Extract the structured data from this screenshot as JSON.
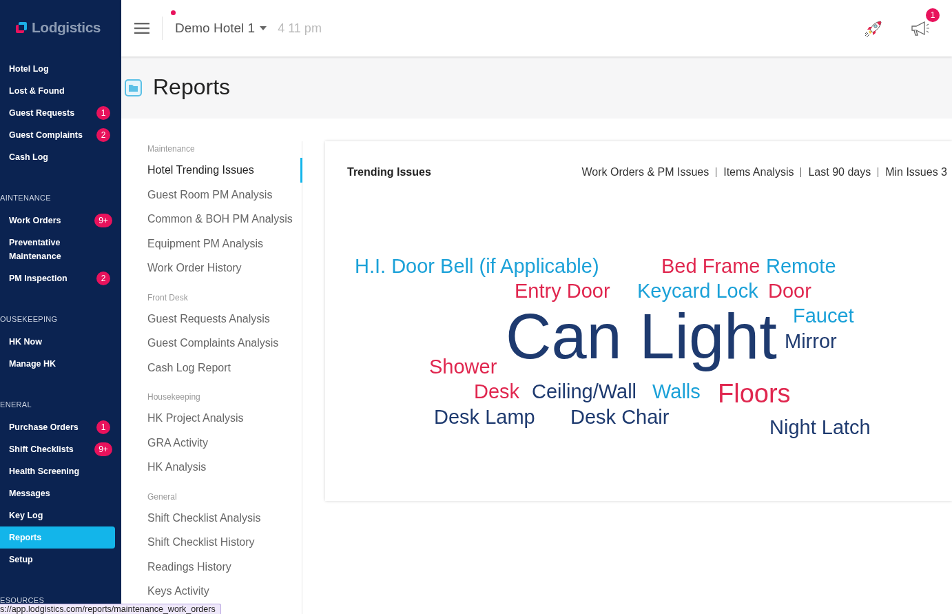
{
  "sidebar": {
    "logo": "Lodgistics",
    "groups": [
      {
        "items": [
          {
            "label": "Hotel Log",
            "selected": false
          },
          {
            "label": "Lost & Found",
            "selected": false
          },
          {
            "label": "Guest Requests",
            "selected": false,
            "badge": "1"
          },
          {
            "label": "Guest Complaints",
            "selected": false,
            "badge": "2"
          },
          {
            "label": "Cash Log",
            "selected": false
          }
        ]
      },
      {
        "header": "AINTENANCE",
        "items": [
          {
            "label": "Work Orders",
            "selected": false,
            "badge": "9+"
          },
          {
            "label": "Preventative Maintenance",
            "selected": false
          },
          {
            "label": "PM Inspection",
            "selected": false,
            "badge": "2"
          }
        ]
      },
      {
        "header": "OUSEKEEPING",
        "items": [
          {
            "label": "HK Now",
            "selected": false
          },
          {
            "label": "Manage HK",
            "selected": false
          }
        ]
      },
      {
        "header": "ENERAL",
        "items": [
          {
            "label": "Purchase Orders",
            "selected": false,
            "badge": "1"
          },
          {
            "label": "Shift Checklists",
            "selected": false,
            "badge": "9+"
          },
          {
            "label": "Health Screening",
            "selected": false
          },
          {
            "label": "Messages",
            "selected": false
          },
          {
            "label": "Key Log",
            "selected": false
          },
          {
            "label": "Reports",
            "selected": true
          },
          {
            "label": "Setup",
            "selected": false
          }
        ]
      },
      {
        "header": "ESOURCES"
      }
    ]
  },
  "topbar": {
    "hotel": "Demo Hotel 1",
    "time": "4 11 pm",
    "notification_badge": "1"
  },
  "page_title": "Reports",
  "report_menu": [
    {
      "header": "Maintenance",
      "items": [
        {
          "label": "Hotel Trending Issues",
          "selected": true
        },
        {
          "label": "Guest Room PM Analysis",
          "selected": false
        },
        {
          "label": "Common & BOH PM Analysis",
          "selected": false
        },
        {
          "label": "Equipment PM Analysis",
          "selected": false
        },
        {
          "label": "Work Order History",
          "selected": false
        }
      ]
    },
    {
      "header": "Front Desk",
      "items": [
        {
          "label": "Guest Requests Analysis",
          "selected": false
        },
        {
          "label": "Guest Complaints Analysis",
          "selected": false
        },
        {
          "label": "Cash Log Report",
          "selected": false
        }
      ]
    },
    {
      "header": "Housekeeping",
      "items": [
        {
          "label": "HK Project Analysis",
          "selected": false
        },
        {
          "label": "GRA Activity",
          "selected": false
        },
        {
          "label": "HK Analysis",
          "selected": false
        }
      ]
    },
    {
      "header": "General",
      "items": [
        {
          "label": "Shift Checklist Analysis",
          "selected": false
        },
        {
          "label": "Shift Checklist History",
          "selected": false
        },
        {
          "label": "Readings History",
          "selected": false
        },
        {
          "label": "Keys Activity",
          "selected": false
        }
      ]
    }
  ],
  "card": {
    "title": "Trending Issues",
    "filters": [
      "Work Orders & PM Issues",
      "Items Analysis",
      "Last 90 days",
      "Min Issues 3"
    ],
    "words": [
      {
        "text": "H.I. Door Bell (if Applicable)",
        "color": "#1ba1d8"
      },
      {
        "text": "Bed Frame",
        "color": "#e0274f"
      },
      {
        "text": "Remote",
        "color": "#1ba1d8"
      },
      {
        "text": "Entry Door",
        "color": "#e0274f"
      },
      {
        "text": "Keycard Lock",
        "color": "#1ba1d8"
      },
      {
        "text": "Door",
        "color": "#e0274f"
      },
      {
        "text": "Can Light",
        "color": "#1e3a6f"
      },
      {
        "text": "Faucet",
        "color": "#1ba1d8"
      },
      {
        "text": "Mirror",
        "color": "#1e3a6f"
      },
      {
        "text": "Shower",
        "color": "#e0274f"
      },
      {
        "text": "Desk",
        "color": "#e0274f"
      },
      {
        "text": "Ceiling/Wall",
        "color": "#1e3a6f"
      },
      {
        "text": "Walls",
        "color": "#1ba1d8"
      },
      {
        "text": "Floors",
        "color": "#e0274f"
      },
      {
        "text": "Desk Lamp",
        "color": "#1e3a6f"
      },
      {
        "text": "Desk Chair",
        "color": "#1e3a6f"
      },
      {
        "text": "Night Latch",
        "color": "#1e3a6f"
      }
    ]
  },
  "status_url": "s://app.lodgistics.com/reports/maintenance_work_orders"
}
